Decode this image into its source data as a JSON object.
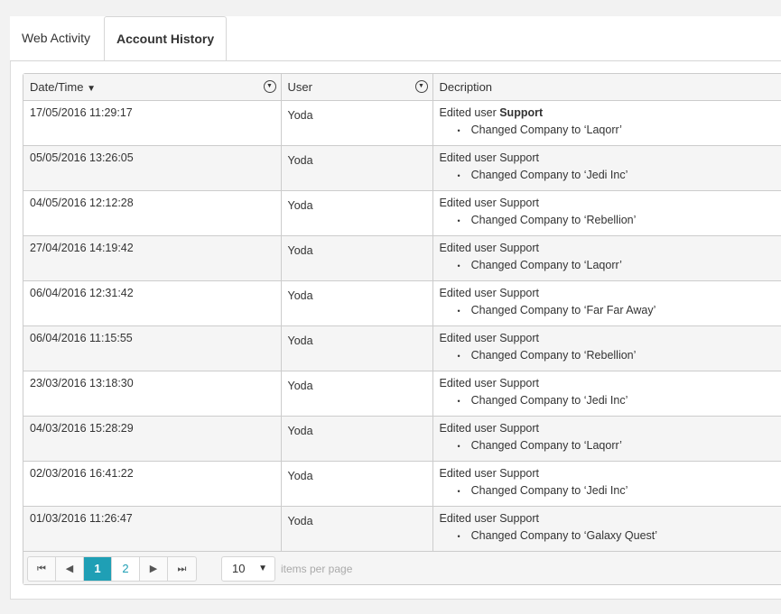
{
  "tabs": [
    {
      "label": "Web Activity"
    },
    {
      "label": "Account History"
    }
  ],
  "columns": {
    "datetime": "Date/Time",
    "sort_icon": "▼",
    "user": "User",
    "description": "Decription"
  },
  "rows": [
    {
      "datetime": "17/05/2016 11:29:17",
      "user": "Yoda",
      "action": "Edited user ",
      "target": "Support",
      "change": "Changed Company to ‘Laqorr’"
    },
    {
      "datetime": "05/05/2016 13:26:05",
      "user": "Yoda",
      "action": "Edited user ",
      "target": "Support",
      "change": "Changed Company to ‘Jedi Inc’"
    },
    {
      "datetime": "04/05/2016 12:12:28",
      "user": "Yoda",
      "action": "Edited user ",
      "target": "Support",
      "change": "Changed Company to ‘Rebellion’"
    },
    {
      "datetime": "27/04/2016 14:19:42",
      "user": "Yoda",
      "action": "Edited user ",
      "target": "Support",
      "change": "Changed Company to ‘Laqorr’"
    },
    {
      "datetime": "06/04/2016 12:31:42",
      "user": "Yoda",
      "action": "Edited user ",
      "target": "Support",
      "change": "Changed Company to ‘Far Far Away’"
    },
    {
      "datetime": "06/04/2016 11:15:55",
      "user": "Yoda",
      "action": "Edited user ",
      "target": "Support",
      "change": "Changed Company to ‘Rebellion’"
    },
    {
      "datetime": "23/03/2016 13:18:30",
      "user": "Yoda",
      "action": "Edited user ",
      "target": "Support",
      "change": "Changed Company to ‘Jedi Inc’"
    },
    {
      "datetime": "04/03/2016 15:28:29",
      "user": "Yoda",
      "action": "Edited user ",
      "target": "Support",
      "change": "Changed Company to ‘Laqorr’"
    },
    {
      "datetime": "02/03/2016 16:41:22",
      "user": "Yoda",
      "action": "Edited user ",
      "target": "Support",
      "change": "Changed Company to ‘Jedi Inc’"
    },
    {
      "datetime": "01/03/2016 11:26:47",
      "user": "Yoda",
      "action": "Edited user ",
      "target": "Support",
      "change": "Changed Company to ‘Galaxy Quest’"
    }
  ],
  "pager": {
    "first": "⏮",
    "prev": "◀",
    "pages": [
      "1",
      "2"
    ],
    "current": "1",
    "next": "▶",
    "last": "⏭",
    "page_size": "10",
    "page_size_arrow": "▼",
    "items_per_page": "items per page"
  },
  "colors": {
    "accent": "#1f9fb5"
  }
}
